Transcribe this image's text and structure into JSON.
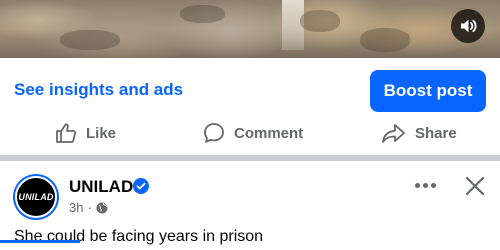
{
  "video": {
    "sound_icon": "speaker-icon"
  },
  "actions": {
    "insights_link": "See insights and ads",
    "boost_button": "Boost post"
  },
  "reactions": {
    "like": "Like",
    "comment": "Comment",
    "share": "Share"
  },
  "post": {
    "page_name": "UNILAD",
    "avatar_text": "UNILAD",
    "time": "3h",
    "separator": "·",
    "caption": "She could be facing years in prison"
  },
  "colors": {
    "accent": "#0866ff",
    "secondary_text": "#65676b",
    "divider": "#c9ccd1"
  }
}
